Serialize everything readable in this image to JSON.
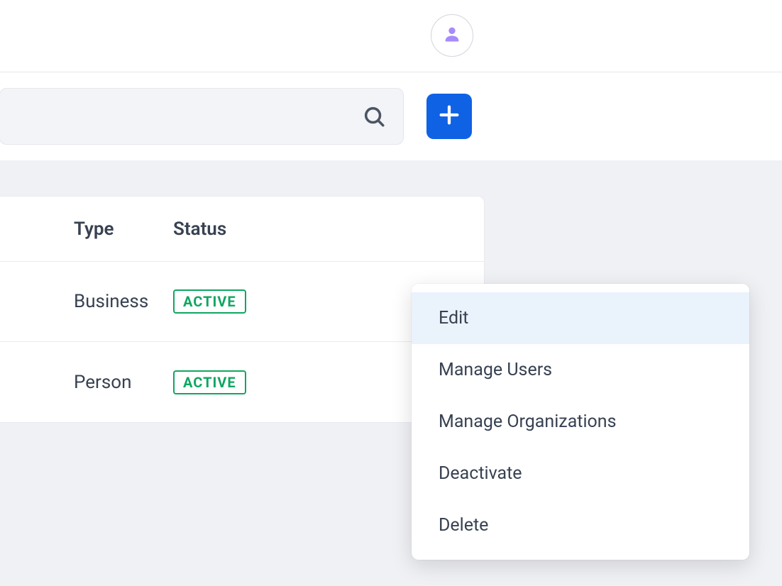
{
  "header": {
    "avatar_icon": "person-icon"
  },
  "toolbar": {
    "search_placeholder": "",
    "search_value": ""
  },
  "table": {
    "columns": {
      "type": "Type",
      "status": "Status"
    },
    "rows": [
      {
        "type": "Business",
        "status": "ACTIVE"
      },
      {
        "type": "Person",
        "status": "ACTIVE"
      }
    ]
  },
  "menu": {
    "items": [
      "Edit",
      "Manage Users",
      "Manage Organizations",
      "Deactivate",
      "Delete"
    ],
    "highlighted_index": 0
  }
}
